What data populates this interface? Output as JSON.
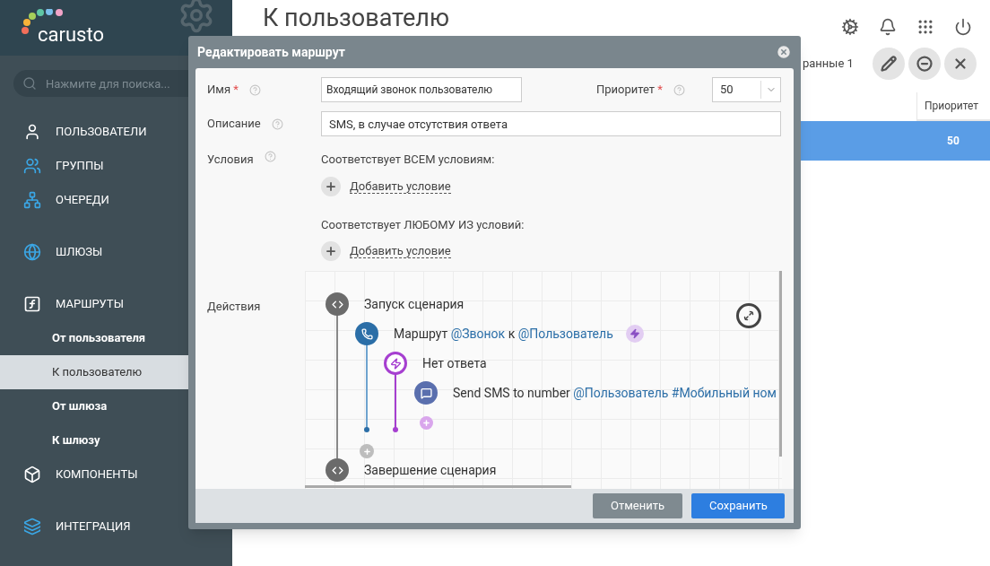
{
  "logo": {
    "text": "carusto"
  },
  "sidebar": {
    "search": {
      "placeholder": "Нажмите для поиска..."
    },
    "sections": [
      [
        {
          "label": "ПОЛЬЗОВАТЕЛИ",
          "kind": "users",
          "selected": false
        },
        {
          "label": "ГРУППЫ",
          "kind": "groups",
          "selected": false
        },
        {
          "label": "ОЧЕРЕДИ",
          "kind": "queues",
          "selected": false
        }
      ],
      [
        {
          "label": "ШЛЮЗЫ",
          "kind": "gateways",
          "selected": false
        }
      ],
      [
        {
          "label": "МАРШРУТЫ",
          "kind": "routes",
          "selected": false,
          "children": [
            {
              "label": "От пользователя",
              "selected": false
            },
            {
              "label": "К пользователю",
              "selected": true
            },
            {
              "label": "От шлюза",
              "selected": false
            },
            {
              "label": "К шлюзу",
              "selected": false
            }
          ]
        },
        {
          "label": "КОМПОНЕНТЫ",
          "kind": "components",
          "selected": false
        }
      ],
      [
        {
          "label": "ИНТЕГРАЦИЯ",
          "kind": "integration",
          "selected": false
        }
      ]
    ]
  },
  "page": {
    "title": "К пользователю",
    "selection_text": "ранные 1",
    "table": {
      "columns": [
        "Приоритет"
      ],
      "rows": [
        {
          "cells": [
            "50"
          ],
          "selected": true
        }
      ]
    }
  },
  "dialog": {
    "title": "Редактировать маршрут",
    "name": {
      "label": "Имя",
      "required_mark": "*",
      "value": "Входящий звонок пользователю"
    },
    "priority": {
      "label": "Приоритет",
      "required_mark": "*",
      "value": "50"
    },
    "description": {
      "label": "Описание",
      "value": "SMS, в случае отсутствия ответа"
    },
    "conditions": {
      "label": "Условия",
      "groups": [
        {
          "heading": "Соответствует ВСЕМ условиям:",
          "add_link": "Добавить условие"
        },
        {
          "heading": "Соответствует ЛЮБОМУ ИЗ условий:",
          "add_link": "Добавить условие"
        }
      ]
    },
    "actions": {
      "label": "Действия",
      "flow": [
        {
          "kind": "start",
          "parts": [
            {
              "text": "Запуск сценария",
              "link": false
            }
          ]
        },
        {
          "kind": "route",
          "parts": [
            {
              "text": "Маршрут",
              "link": false
            },
            {
              "text": "@Звонок",
              "link": true
            },
            {
              "text": "к",
              "link": false
            },
            {
              "text": "@Пользователь",
              "link": true
            }
          ]
        },
        {
          "kind": "event",
          "parts": [
            {
              "text": "Нет ответа",
              "link": false
            }
          ]
        },
        {
          "kind": "sms",
          "parts": [
            {
              "text": "Send SMS to number",
              "link": false
            },
            {
              "text": "@Пользователь #Мобильный ном",
              "link": true
            }
          ]
        },
        {
          "kind": "end",
          "parts": [
            {
              "text": "Завершение сценария",
              "link": false
            }
          ]
        }
      ]
    },
    "buttons": [
      {
        "label": "Отменить",
        "kind": "secondary"
      },
      {
        "label": "Сохранить",
        "kind": "primary"
      }
    ]
  }
}
